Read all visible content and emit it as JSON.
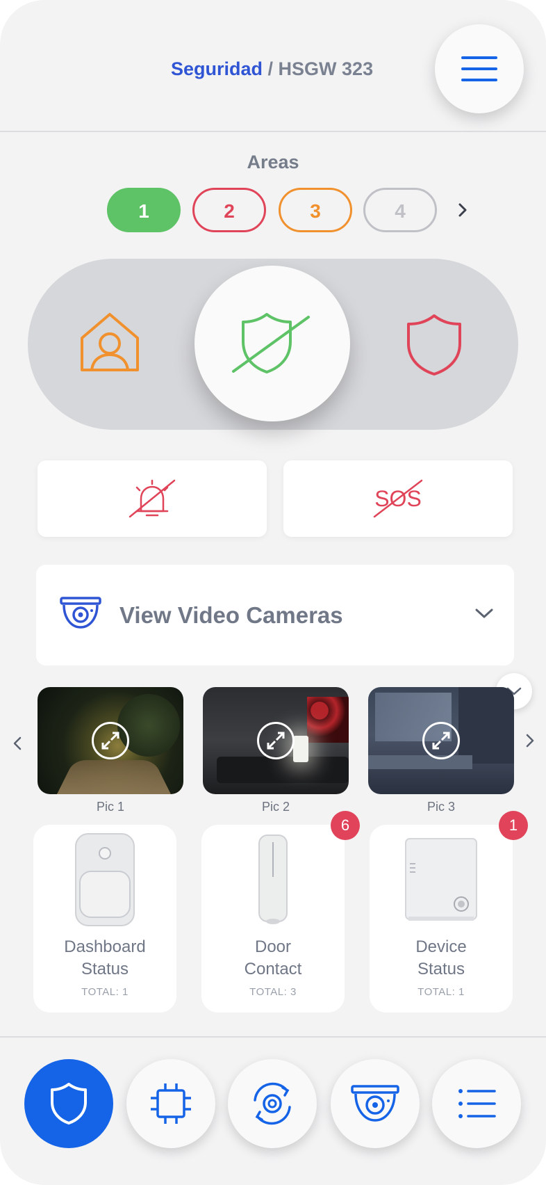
{
  "header": {
    "breadcrumb_link": "Seguridad",
    "breadcrumb_separator": " / ",
    "breadcrumb_current": "HSGW 323",
    "menu_icon": "hamburger-menu-icon"
  },
  "areas": {
    "title": "Areas",
    "items": [
      {
        "label": "1",
        "color": "#5ec266",
        "selected": true
      },
      {
        "label": "2",
        "color": "#e04458",
        "selected": false
      },
      {
        "label": "3",
        "color": "#f0912e",
        "selected": false
      },
      {
        "label": "4",
        "color": "#bfc1c6",
        "selected": false
      }
    ],
    "next_icon": "chevron-right-icon"
  },
  "mode_switch": {
    "options": [
      {
        "icon": "home-user-icon",
        "color": "#f0912e"
      },
      {
        "icon": "shield-off-icon",
        "color": "#5ec266",
        "selected": true
      },
      {
        "icon": "shield-icon",
        "color": "#e04458"
      }
    ]
  },
  "quick_actions": [
    {
      "icon": "alarm-bell-off-icon",
      "color": "#e04458"
    },
    {
      "label": "SOS",
      "icon": "sos-off-icon",
      "color": "#e04458"
    }
  ],
  "cameras": {
    "label": "View Video Cameras",
    "icon": "security-camera-icon",
    "chevron": "chevron-down-icon",
    "pictures": [
      {
        "label": "Pic 1"
      },
      {
        "label": "Pic 2"
      },
      {
        "label": "Pic 3"
      }
    ]
  },
  "devices": [
    {
      "name_line1": "Dashboard",
      "name_line2": "Status",
      "total": "TOTAL: 1",
      "badge": null
    },
    {
      "name_line1": "Door",
      "name_line2": "Contact",
      "total": "TOTAL: 3",
      "badge": "6"
    },
    {
      "name_line1": "Device",
      "name_line2": "Status",
      "total": "TOTAL: 1",
      "badge": "1"
    }
  ],
  "bottom_nav": [
    {
      "icon": "shield-icon",
      "active": true
    },
    {
      "icon": "chip-icon",
      "active": false
    },
    {
      "icon": "gear-sync-icon",
      "active": false
    },
    {
      "icon": "security-camera-icon",
      "active": false
    },
    {
      "icon": "list-icon",
      "active": false
    }
  ],
  "colors": {
    "accent": "#1563e6",
    "link": "#2f55d4",
    "badge": "#e0435a",
    "background": "#f3f3f4"
  }
}
